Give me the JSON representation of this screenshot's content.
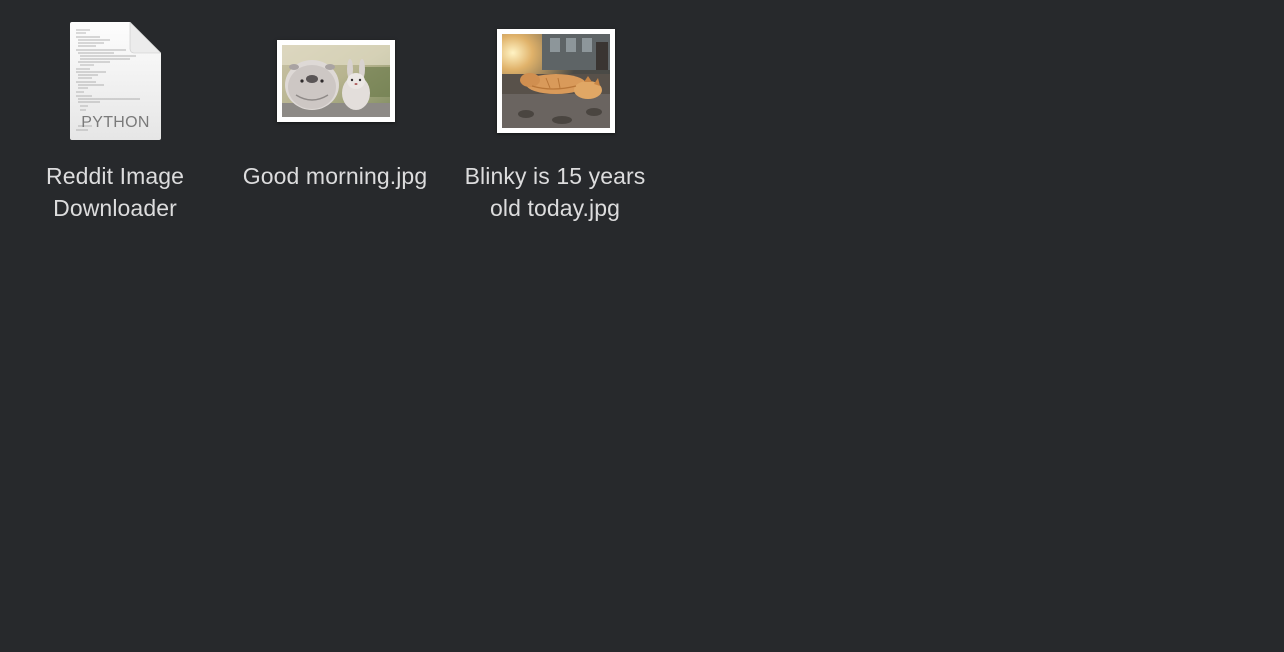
{
  "desktop": {
    "background": "#27292c",
    "files": [
      {
        "label": "Reddit Image Downloader",
        "kind_badge": "PYTHON",
        "icon": "python-document-icon"
      },
      {
        "label": "Good morning.jpg",
        "icon": "image-thumbnail-icon"
      },
      {
        "label": "Blinky is 15 years old today.jpg",
        "icon": "image-thumbnail-icon"
      }
    ]
  },
  "colors": {
    "label_text": "#dcdcdd",
    "thumb_frame": "#ffffff"
  }
}
